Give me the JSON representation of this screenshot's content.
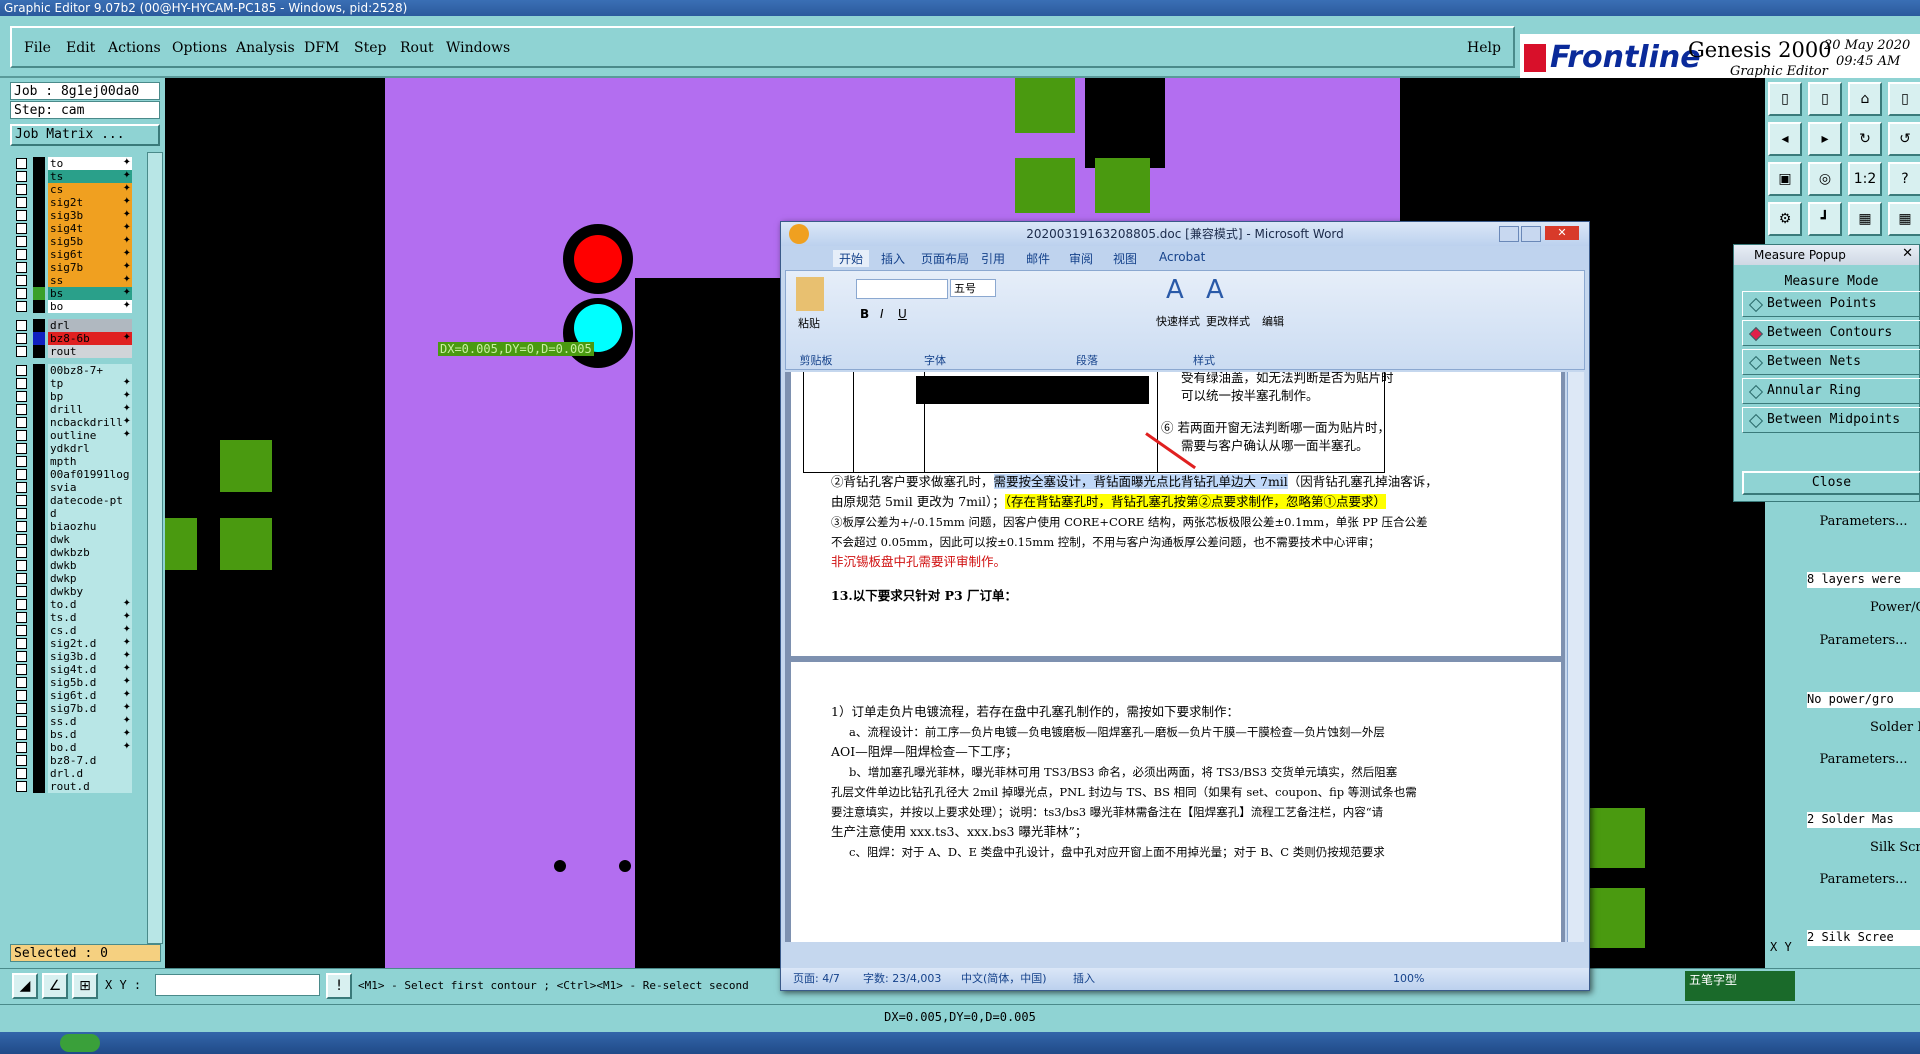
{
  "app": {
    "title": "Graphic Editor 9.07b2 (00@HY-HYCAM-PC185 - Windows, pid:2528)"
  },
  "menu": {
    "items": [
      "File",
      "Edit",
      "Actions",
      "Options",
      "Analysis",
      "DFM",
      "Step",
      "Rout",
      "Windows"
    ],
    "help": "Help"
  },
  "logo": {
    "brand": "Frontline",
    "product": "Genesis 2000",
    "subtitle": "Graphic Editor",
    "date": "20 May 2020",
    "time": "09:45 AM"
  },
  "job": {
    "job_label": "Job : 8g1ej00da0",
    "step_label": "Step: cam",
    "matrix_button": "Job Matrix ...",
    "selected_label": "Selected : 0"
  },
  "layers": [
    {
      "name": "to",
      "color": "#000000",
      "bg": "#ffffff",
      "mark": "✦"
    },
    {
      "name": "ts",
      "color": "#000000",
      "bg": "#2aa08a",
      "mark": "✦"
    },
    {
      "name": "cs",
      "color": "#000000",
      "bg": "#f0a020",
      "mark": "✦"
    },
    {
      "name": "sig2t",
      "color": "#000000",
      "bg": "#f0a020",
      "mark": "✦"
    },
    {
      "name": "sig3b",
      "color": "#000000",
      "bg": "#f0a020",
      "mark": "✦"
    },
    {
      "name": "sig4t",
      "color": "#000000",
      "bg": "#f0a020",
      "mark": "✦"
    },
    {
      "name": "sig5b",
      "color": "#000000",
      "bg": "#f0a020",
      "mark": "✦"
    },
    {
      "name": "sig6t",
      "color": "#000000",
      "bg": "#f0a020",
      "mark": "✦"
    },
    {
      "name": "sig7b",
      "color": "#000000",
      "bg": "#f0a020",
      "mark": "✦"
    },
    {
      "name": "ss",
      "color": "#000000",
      "bg": "#f0a020",
      "mark": "✦"
    },
    {
      "name": "bs",
      "color": "#3aa02a",
      "bg": "#2aa08a",
      "mark": "✦"
    },
    {
      "name": "bo",
      "color": "#000000",
      "bg": "#ffffff",
      "mark": "✦"
    },
    {
      "name": "drl",
      "color": "#000000",
      "bg": "#b0b8c0",
      "mark": ""
    },
    {
      "name": "bz8-6b",
      "color": "#1020c0",
      "bg": "#e02020",
      "mark": "✦"
    },
    {
      "name": "rout",
      "color": "#000000",
      "bg": "#d0d4d8",
      "mark": ""
    },
    {
      "name": "00bz8-7+",
      "color": "#000000",
      "bg": "#b8e6e6",
      "mark": ""
    },
    {
      "name": "tp",
      "color": "#000000",
      "bg": "#b8e6e6",
      "mark": "✦"
    },
    {
      "name": "bp",
      "color": "#000000",
      "bg": "#b8e6e6",
      "mark": "✦"
    },
    {
      "name": "drill",
      "color": "#000000",
      "bg": "#b8e6e6",
      "mark": "✦"
    },
    {
      "name": "ncbackdrill",
      "color": "#000000",
      "bg": "#b8e6e6",
      "mark": "✦"
    },
    {
      "name": "outline",
      "color": "#000000",
      "bg": "#b8e6e6",
      "mark": "✦"
    },
    {
      "name": "ydkdrl",
      "color": "#000000",
      "bg": "#b8e6e6",
      "mark": ""
    },
    {
      "name": "mpth",
      "color": "#000000",
      "bg": "#b8e6e6",
      "mark": ""
    },
    {
      "name": "00af01991log",
      "color": "#000000",
      "bg": "#b8e6e6",
      "mark": ""
    },
    {
      "name": "svia",
      "color": "#000000",
      "bg": "#b8e6e6",
      "mark": ""
    },
    {
      "name": "datecode-pt",
      "color": "#000000",
      "bg": "#b8e6e6",
      "mark": ""
    },
    {
      "name": "d",
      "color": "#000000",
      "bg": "#b8e6e6",
      "mark": ""
    },
    {
      "name": "biaozhu",
      "color": "#000000",
      "bg": "#b8e6e6",
      "mark": ""
    },
    {
      "name": "dwk",
      "color": "#000000",
      "bg": "#b8e6e6",
      "mark": ""
    },
    {
      "name": "dwkbzb",
      "color": "#000000",
      "bg": "#b8e6e6",
      "mark": ""
    },
    {
      "name": "dwkb",
      "color": "#000000",
      "bg": "#b8e6e6",
      "mark": ""
    },
    {
      "name": "dwkp",
      "color": "#000000",
      "bg": "#b8e6e6",
      "mark": ""
    },
    {
      "name": "dwkby",
      "color": "#000000",
      "bg": "#b8e6e6",
      "mark": ""
    },
    {
      "name": "to.d",
      "color": "#000000",
      "bg": "#b8e6e6",
      "mark": "✦"
    },
    {
      "name": "ts.d",
      "color": "#000000",
      "bg": "#b8e6e6",
      "mark": "✦"
    },
    {
      "name": "cs.d",
      "color": "#000000",
      "bg": "#b8e6e6",
      "mark": "✦"
    },
    {
      "name": "sig2t.d",
      "color": "#000000",
      "bg": "#b8e6e6",
      "mark": "✦"
    },
    {
      "name": "sig3b.d",
      "color": "#000000",
      "bg": "#b8e6e6",
      "mark": "✦"
    },
    {
      "name": "sig4t.d",
      "color": "#000000",
      "bg": "#b8e6e6",
      "mark": "✦"
    },
    {
      "name": "sig5b.d",
      "color": "#000000",
      "bg": "#b8e6e6",
      "mark": "✦"
    },
    {
      "name": "sig6t.d",
      "color": "#000000",
      "bg": "#b8e6e6",
      "mark": "✦"
    },
    {
      "name": "sig7b.d",
      "color": "#000000",
      "bg": "#b8e6e6",
      "mark": "✦"
    },
    {
      "name": "ss.d",
      "color": "#000000",
      "bg": "#b8e6e6",
      "mark": "✦"
    },
    {
      "name": "bs.d",
      "color": "#000000",
      "bg": "#b8e6e6",
      "mark": "✦"
    },
    {
      "name": "bo.d",
      "color": "#000000",
      "bg": "#b8e6e6",
      "mark": "✦"
    },
    {
      "name": "bz8-7.d",
      "color": "#000000",
      "bg": "#b8e6e6",
      "mark": ""
    },
    {
      "name": "drl.d",
      "color": "#000000",
      "bg": "#b8e6e6",
      "mark": ""
    },
    {
      "name": "rout.d",
      "color": "#000000",
      "bg": "#b8e6e6",
      "mark": ""
    }
  ],
  "canvas": {
    "measure_readout": "DX=0.005,DY=0,D=0.005",
    "colors": {
      "board": "#b36ef0",
      "copper": "#000000",
      "pad": "#4a9a10",
      "hole_red": "#ff0000",
      "hole_cyan": "#00ffff"
    }
  },
  "measure_popup": {
    "title": "Measure Popup",
    "mode_label": "Measure Mode",
    "items": [
      "Between Points",
      "Between Contours",
      "Between Nets",
      "Annular Ring",
      "Between Midpoints"
    ],
    "selected": "Between Contours",
    "close": "Close"
  },
  "right_panel": {
    "params": [
      "Parameters...",
      "Parameters...",
      "Parameters...",
      "Parameters..."
    ],
    "texts": [
      "8 layers were",
      "No power/gro",
      "2 Solder Mas",
      "2 Silk Scree"
    ],
    "checks": [
      "Power/G",
      "Solder M",
      "Silk Scr"
    ]
  },
  "bottom": {
    "xy_label": "X Y :",
    "prompt": "<M1> - Select first contour ; <Ctrl><M1> - Re-select second",
    "status": "DX=0.005,DY=0,D=0.005",
    "ime": "五笔字型",
    "xy_side": "X Y"
  },
  "word": {
    "title": "20200319163208805.doc [兼容模式] - Microsoft Word",
    "tabs": [
      "开始",
      "插入",
      "页面布局",
      "引用",
      "邮件",
      "审阅",
      "视图",
      "Acrobat"
    ],
    "groups": [
      "剪贴板",
      "字体",
      "段落",
      "样式"
    ],
    "paste": "粘贴",
    "font_size": "五号",
    "quick_style": "快速样式",
    "change_style": "更改样式",
    "edit": "编辑",
    "doc_lines": [
      "受有绿油盖，如无法判断是否为贴片时",
      "可以统一按半塞孔制作。",
      "⑥  若两面开窗无法判断哪一面为贴片时，",
      "需要与客户确认从哪一面半塞孔。"
    ],
    "para2_a": "②背钻孔客户要求做塞孔时，",
    "para2_b": "需要按全塞设计，背钻面曝光点比背钻孔单边大 7mil",
    "para2_c": "（因背钻孔塞孔掉油客诉，",
    "para2_d": "由原规范 5mil 更改为 7mil）；",
    "para2_e": "（存在背钻塞孔时，背钻孔塞孔按第②点要求制作，忽略第①点要求）",
    "para3_a": "③板厚公差为+/-0.15mm 问题，因客户使用 CORE+CORE 结构，两张芯板极限公差±0.1mm，单张 PP 压合公差",
    "para3_b": "不会超过 0.05mm，因此可以按±0.15mm 控制，不用与客户沟通板厚公差问题，也不需要技术中心评审；",
    "para3_red": "非沉锡板盘中孔需要评审制作。",
    "heading13": "13.以下要求只针对 P3 厂订单：",
    "page2_lines": [
      "1）订单走负片电镀流程，若存在盘中孔塞孔制作的，需按如下要求制作：",
      "a、流程设计：前工序—负片电镀—负电镀磨板—阻焊塞孔—磨板—负片干膜—干膜检查—负片蚀刻—外层",
      "AOI—阻焊—阻焊检查—下工序；",
      "b、增加塞孔曝光菲林，曝光菲林可用 TS3/BS3 命名，必须出两面，将 TS3/BS3 交货单元填实，然后阻塞",
      "孔层文件单边比钻孔孔径大 2mil 掉曝光点，PNL 封边与 TS、BS 相同（如果有 set、coupon、fip 等测试条也需",
      "要注意填实，并按以上要求处理）；说明：ts3/bs3 曝光菲林需备注在【阻焊塞孔】流程工艺备注栏，内容“请",
      "生产注意使用 xxx.ts3、xxx.bs3 曝光菲林”；",
      "c、阻焊：对于 A、D、E 类盘中孔设计，盘中孔对应开窗上面不用掉光量；对于 B、C 类则仍按规范要求"
    ],
    "status_page": "页面: 4/7",
    "status_words": "字数: 23/4,003",
    "status_lang": "中文(简体，中国)",
    "status_insert": "插入",
    "zoom": "100%"
  }
}
